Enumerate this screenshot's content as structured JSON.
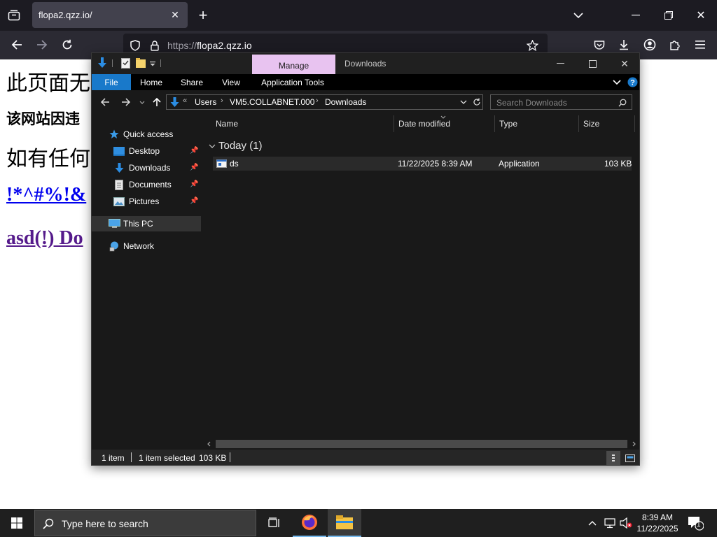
{
  "browser": {
    "tab_title": "flopa2.qzz.io/",
    "url_scheme": "https://",
    "url_host": "flopa2.qzz.io"
  },
  "webpage": {
    "line1": "此页面无",
    "line2": "该网站因违",
    "line3": "如有任何",
    "link1": "!*^#%!&",
    "link2": "asd(!) Do",
    "link1_color": "#0000ee",
    "link2_color": "#551a8b"
  },
  "explorer": {
    "context_tab": "Manage",
    "window_title": "Downloads",
    "ribbon_tabs": [
      "File",
      "Home",
      "Share",
      "View",
      "Application Tools"
    ],
    "breadcrumbs": [
      "Users",
      "VM5.COLLABNET.000",
      "Downloads"
    ],
    "search_placeholder": "Search Downloads",
    "nav": {
      "quick_access": "Quick access",
      "desktop": "Desktop",
      "downloads": "Downloads",
      "documents": "Documents",
      "pictures": "Pictures",
      "this_pc": "This PC",
      "network": "Network"
    },
    "columns": [
      "Name",
      "Date modified",
      "Type",
      "Size"
    ],
    "group_label": "Today (1)",
    "files": [
      {
        "name": "ds",
        "date_modified": "11/22/2025 8:39 AM",
        "type": "Application",
        "size": "103 KB"
      }
    ],
    "status": {
      "item_count": "1 item",
      "selection": "1 item selected",
      "selection_size": "103 KB"
    },
    "accent_color": "#1979ca",
    "manage_color": "#e8c3f0"
  },
  "taskbar": {
    "search_placeholder": "Type here to search",
    "time": "8:39 AM",
    "date": "11/22/2025",
    "notification_count": "1"
  }
}
